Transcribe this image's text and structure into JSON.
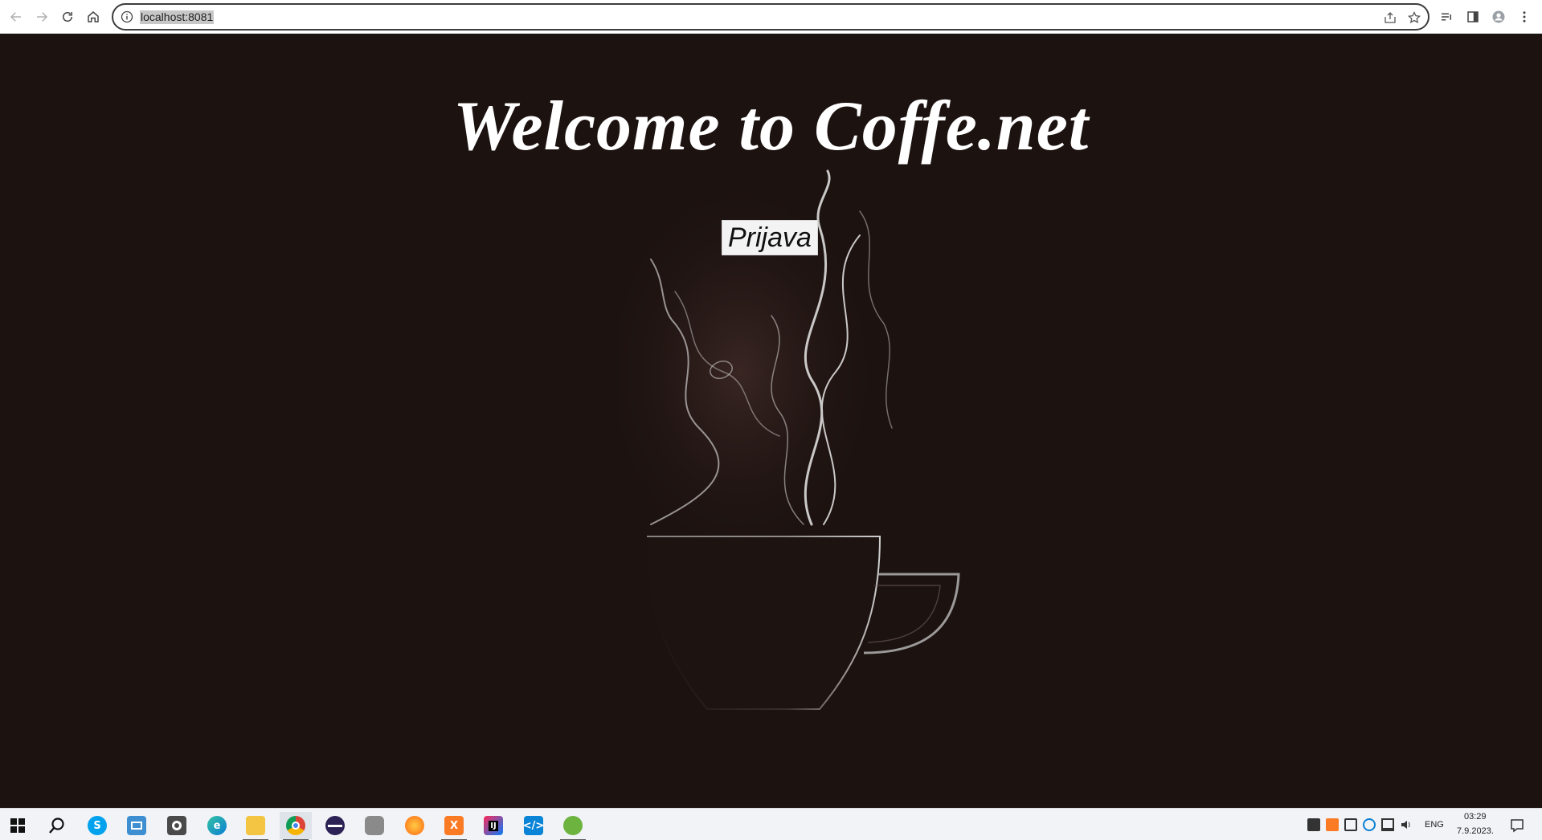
{
  "browser": {
    "url": "localhost:8081"
  },
  "page": {
    "heading": "Welcome to Coffe.net",
    "login_button": "Prijava"
  },
  "taskbar": {
    "apps": [
      "start-icon",
      "search-icon",
      "skype-icon",
      "window-icon",
      "camera-icon",
      "edge-icon",
      "file-explorer-icon",
      "chrome-icon",
      "eclipse-icon",
      "database-icon",
      "firefox-icon",
      "xampp-icon",
      "intellij-icon",
      "vscode-icon",
      "spring-icon"
    ],
    "tray": {
      "language": "ENG",
      "time": "03:29",
      "date": "7.9.2023."
    }
  },
  "colors": {
    "page_background": "#1c1210",
    "heading_text": "#ffffff",
    "button_background": "#f3f3f3"
  }
}
